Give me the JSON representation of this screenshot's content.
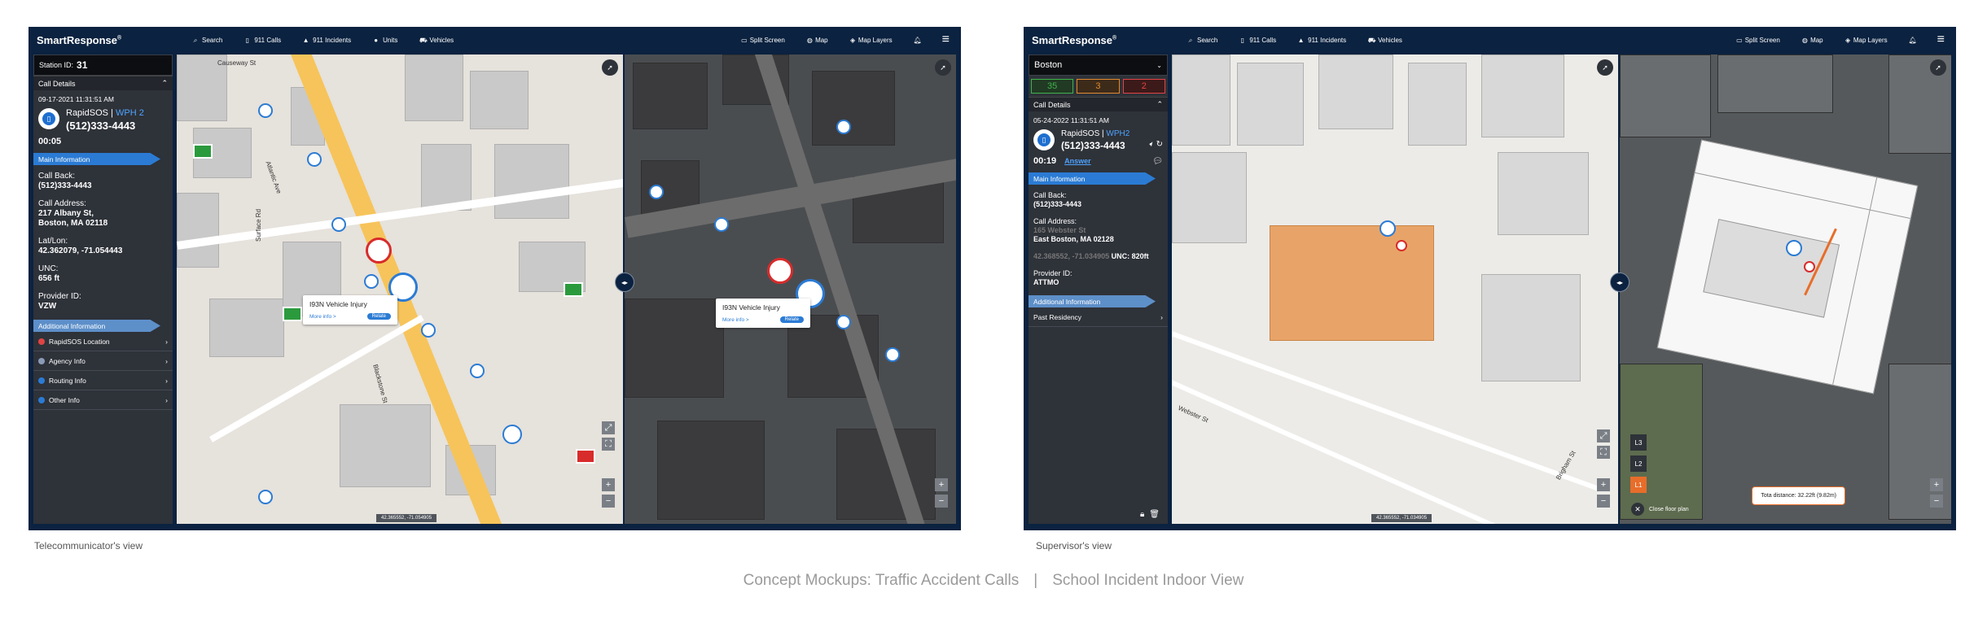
{
  "app": {
    "brand": "SmartResponse",
    "brand_mark": "®"
  },
  "left": {
    "nav": [
      "Search",
      "911 Calls",
      "911 Incidents",
      "Units",
      "Vehicles"
    ],
    "nav_right": [
      "Split Screen",
      "Map",
      "Map Layers"
    ],
    "station_label": "Station ID:",
    "station_id": "31",
    "call_details": "Call Details",
    "timestamp": "09-17-2021 11:31:51 AM",
    "caller_name": "RapidSOS",
    "caller_tag": "WPH 2",
    "caller_number": "(512)333-4443",
    "timer": "00:05",
    "main_info": "Main Information",
    "callback_label": "Call Back:",
    "callback_value": "(512)333-4443",
    "address_label": "Call Address:",
    "address_line1": "217 Albany St,",
    "address_line2": "Boston, MA 02118",
    "latlon_label": "Lat/Lon:",
    "latlon_value": "42.362079, -71.054443",
    "unc_label": "UNC:",
    "unc_value": "656 ft",
    "provider_label": "Provider ID:",
    "provider_value": "VZW",
    "additional_info": "Additional Information",
    "additional_items": [
      "RapidSOS Location",
      "Agency Info",
      "Routing Info",
      "Other Info"
    ],
    "popup_title": "I93N Vehicle Injury",
    "popup_more": "More info >",
    "popup_button": "Relate",
    "popup2_title": "I93N Vehicle Injury",
    "coord": "42.365552, -71.054905",
    "streets": [
      "Causeway St",
      "Atlantic Ave",
      "Blackstone St",
      "Surface Rd"
    ]
  },
  "right": {
    "nav": [
      "Search",
      "911 Calls",
      "911 Incidents",
      "Vehicles"
    ],
    "nav_right": [
      "Split Screen",
      "Map",
      "Map Layers"
    ],
    "city": "Boston",
    "counts": [
      "35",
      "3",
      "2"
    ],
    "call_details": "Call Details",
    "timestamp": "05-24-2022 11:31:51 AM",
    "caller_name": "RapidSOS",
    "caller_tag": "WPH2",
    "caller_number": "(512)333-4443",
    "timer": "00:19",
    "answer": "Answer",
    "main_info": "Main Information",
    "callback_label": "Call Back:",
    "callback_value": "(512)333-4443",
    "address_label": "Call Address:",
    "address_line1": "165 Webster St",
    "address_line2": "East Boston, MA 02128",
    "latlon_blur": "42.368552, -71.034905",
    "unc_value": "UNC: 820ft",
    "provider_label": "Provider ID:",
    "provider_value": "ATTMO",
    "additional_info": "Additional Information",
    "past_residency": "Past Residency",
    "coord": "42.365552, -71.034905",
    "floors": [
      "L3",
      "L2",
      "L1"
    ],
    "close_floor_plan": "Close floor plan",
    "distance": "Tota distance: 32.22ft (9.82m)",
    "streets": [
      "Brigham St",
      "Webster St"
    ]
  },
  "captions": {
    "left_view": "Telecommunicator's view",
    "right_view": "Supervisor's view",
    "main_left": "Concept Mockups: Traffic Accident Calls",
    "separator": "|",
    "main_right": "School Incident Indoor View"
  },
  "colors": {
    "frame": "#0b2240",
    "accent": "#2b7bd4",
    "building_highlight": "#e8a468",
    "floor_active": "#e86d2a"
  }
}
